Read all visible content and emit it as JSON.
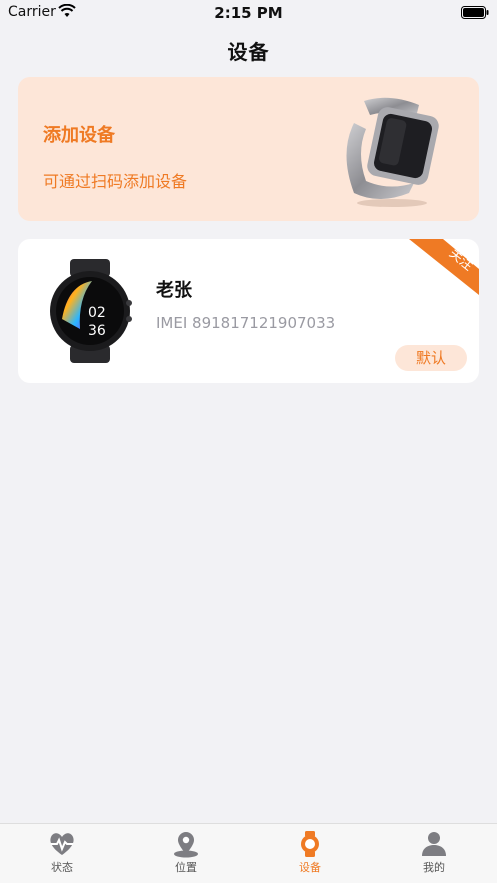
{
  "status_bar": {
    "carrier": "Carrier",
    "time": "2:15 PM"
  },
  "nav": {
    "title": "设备"
  },
  "add_card": {
    "title": "添加设备",
    "subtitle": "可通过扫码添加设备"
  },
  "device": {
    "name": "老张",
    "imei": "IMEI 891817121907033",
    "ribbon": "关注",
    "default_label": "默认",
    "watch_face": {
      "hour": "02",
      "minute": "36"
    }
  },
  "tabs": [
    {
      "label": "状态",
      "icon": "heart-pulse-icon",
      "active": false
    },
    {
      "label": "位置",
      "icon": "location-pin-icon",
      "active": false
    },
    {
      "label": "设备",
      "icon": "watch-icon",
      "active": true
    },
    {
      "label": "我的",
      "icon": "person-icon",
      "active": false
    }
  ],
  "colors": {
    "accent": "#ef7a24",
    "accent_light": "#fde6d8",
    "background": "#f2f2f5"
  }
}
